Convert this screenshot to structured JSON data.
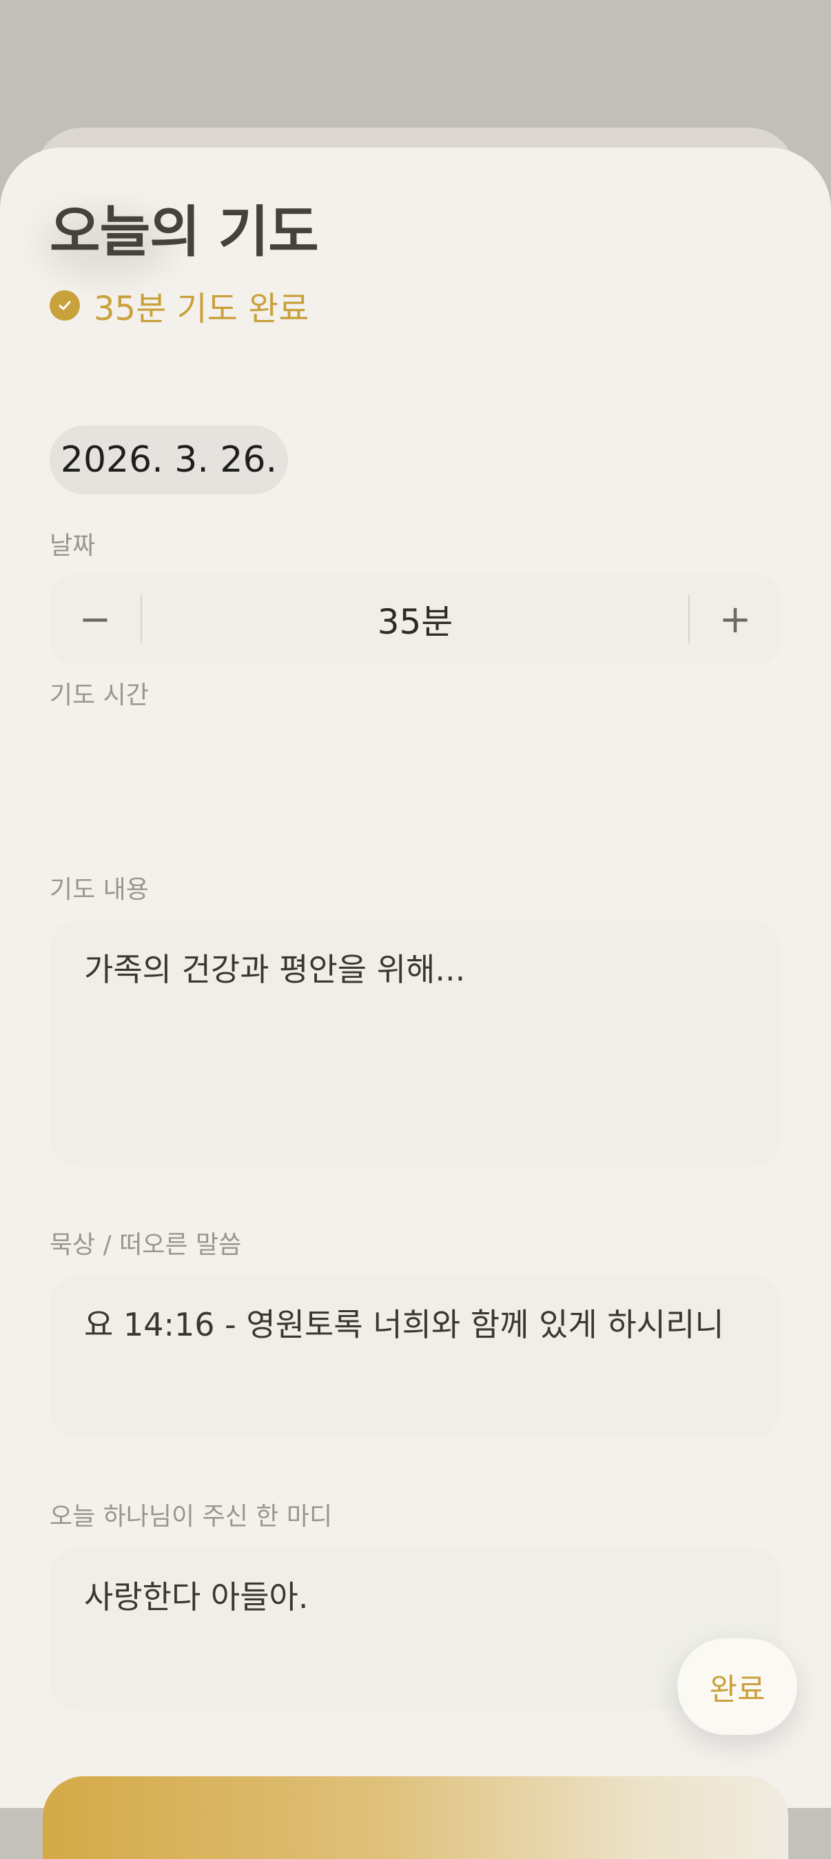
{
  "page": {
    "title": "오늘의 기도",
    "status_text": "35분 기도 완료"
  },
  "date": {
    "label": "날짜",
    "value": "2026. 3. 26."
  },
  "duration": {
    "label": "기도 시간",
    "value": "35분",
    "decrement": "−",
    "increment": "+"
  },
  "prayer": {
    "label": "기도 내용",
    "value": "가족의 건강과 평안을 위해..."
  },
  "meditation": {
    "label": "묵상 / 떠오른 말씀",
    "value": "요 14:16 - 영원토록 너희와 함께 있게 하시리니"
  },
  "word": {
    "label": "오늘 하나님이 주신 한 마디",
    "value": "사랑한다 아들아."
  },
  "actions": {
    "done_label": "완료"
  },
  "colors": {
    "accent": "#c9a13c",
    "sheet_bg": "#f4f1ec",
    "field_bg": "#efeee8",
    "text_primary": "#46423a",
    "label_gray": "#9a958d"
  }
}
